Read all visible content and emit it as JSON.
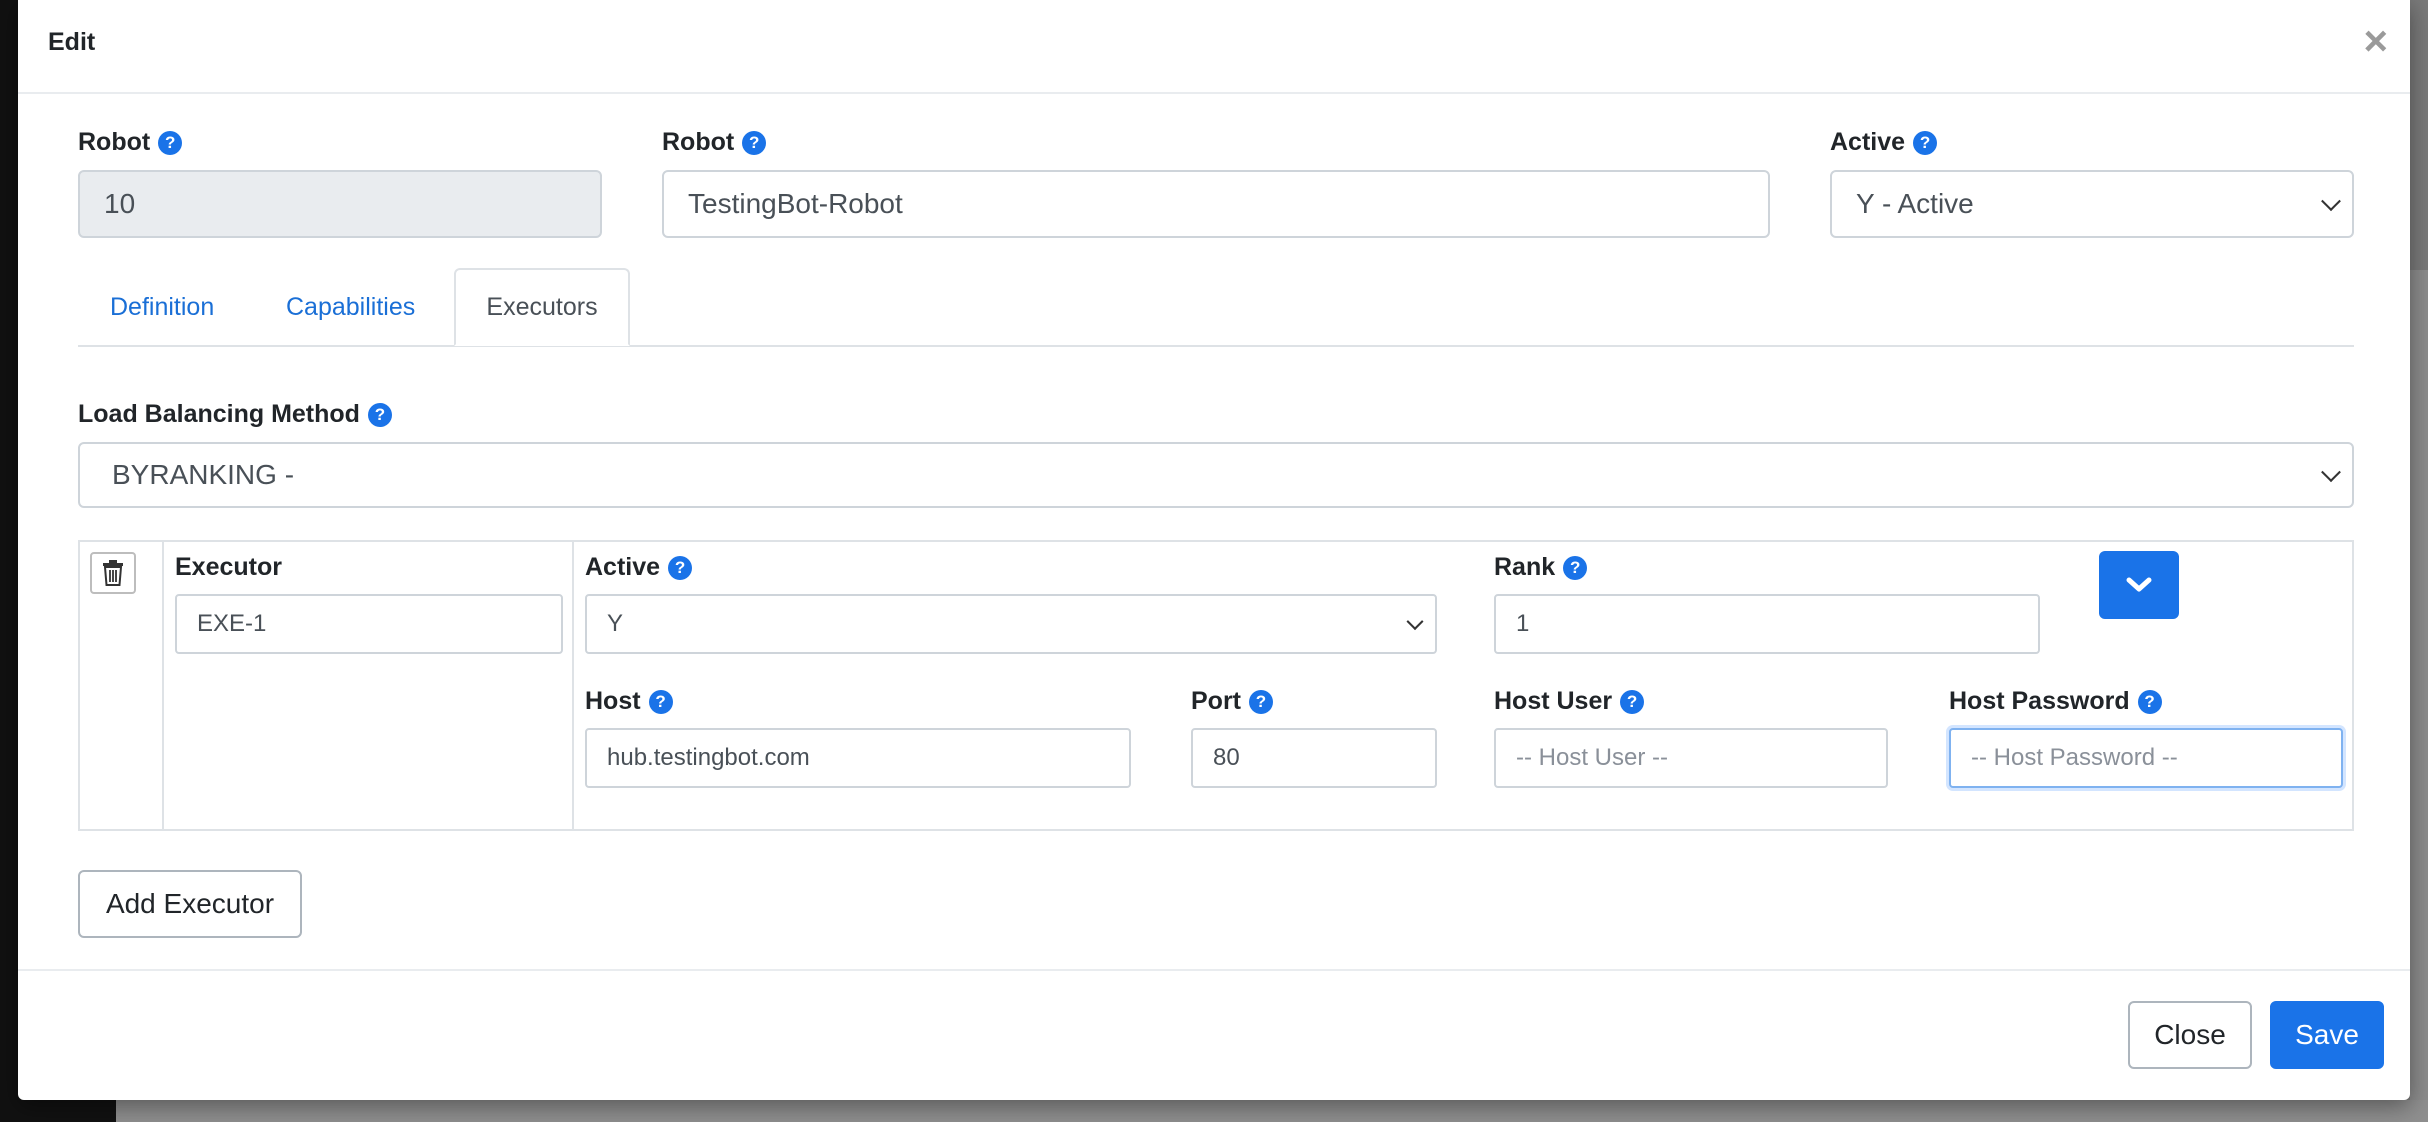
{
  "modal": {
    "title": "Edit",
    "close_symbol": "×"
  },
  "robot_id": {
    "label": "Robot",
    "value": "10"
  },
  "robot_name": {
    "label": "Robot",
    "value": "TestingBot-Robot"
  },
  "robot_active": {
    "label": "Active",
    "value": "Y - Active"
  },
  "tabs": [
    {
      "label": "Definition"
    },
    {
      "label": "Capabilities"
    },
    {
      "label": "Executors"
    }
  ],
  "load_balancing": {
    "label": "Load Balancing Method",
    "value": "BYRANKING -"
  },
  "executor": {
    "name": {
      "label": "Executor",
      "value": "EXE-1"
    },
    "active": {
      "label": "Active",
      "value": "Y"
    },
    "rank": {
      "label": "Rank",
      "value": "1"
    },
    "host": {
      "label": "Host",
      "value": "hub.testingbot.com"
    },
    "port": {
      "label": "Port",
      "value": "80"
    },
    "host_user": {
      "label": "Host User",
      "placeholder": "-- Host User --"
    },
    "host_password": {
      "label": "Host Password",
      "placeholder": "-- Host Password --"
    }
  },
  "buttons": {
    "add_executor": "Add Executor",
    "close": "Close",
    "save": "Save"
  },
  "help_glyph": "?",
  "icons": [
    "help-icon",
    "trash-icon",
    "chevron-down-icon",
    "close-icon"
  ],
  "colors": {
    "primary": "#1a73e8",
    "link": "#1a6fd6"
  }
}
